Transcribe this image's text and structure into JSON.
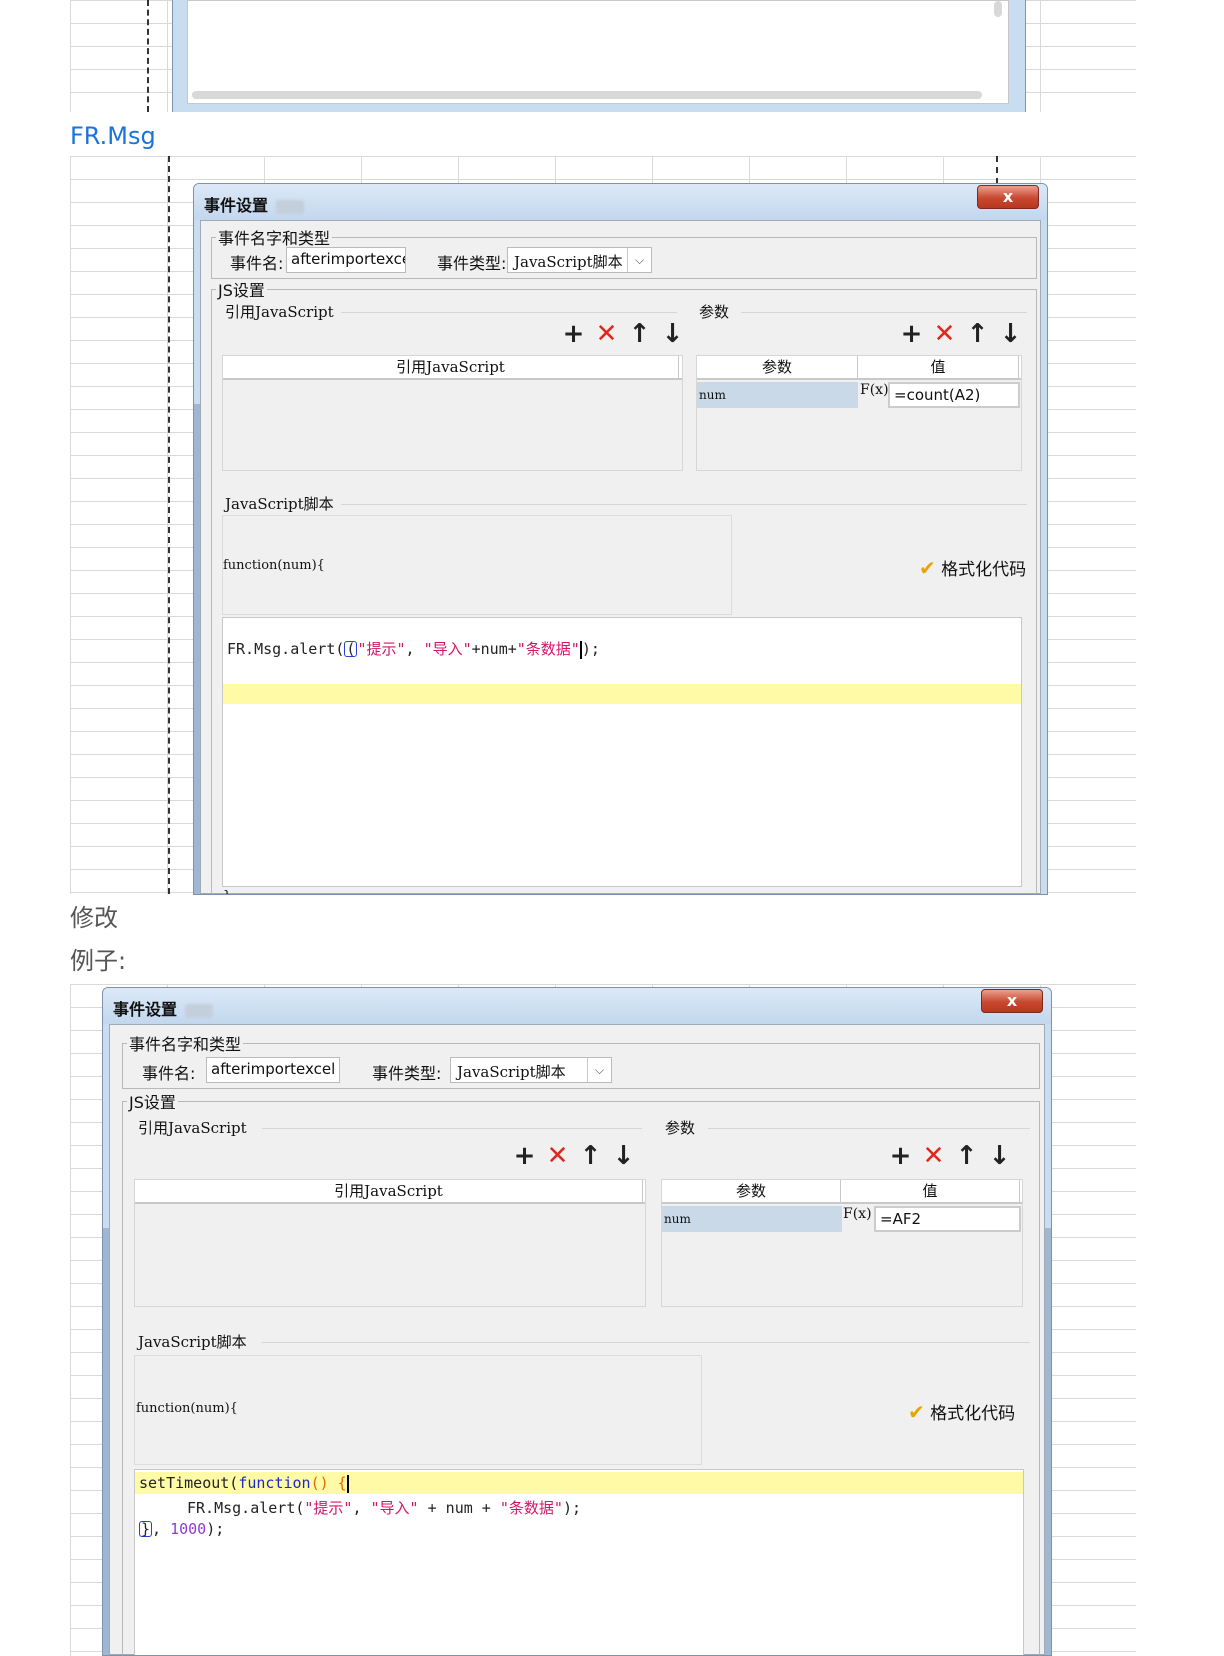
{
  "section1": {
    "heading": "FR.Msg"
  },
  "section2": {
    "heading": "修改"
  },
  "section3": {
    "heading": "例子:"
  },
  "dialog": {
    "title": "事件设置",
    "close_label": "x",
    "name_group_legend": "事件名字和类型",
    "event_name_label": "事件名:",
    "event_name_value": "afterimportexcel",
    "event_type_label": "事件类型:",
    "event_type_value": "JavaScript脚本",
    "js_group_legend": "JS设置",
    "ref_js_section": "引用JavaScript",
    "params_section": "参数",
    "toolbar": {
      "add": "+",
      "delete": "✕",
      "up": "↑",
      "down": "↓"
    },
    "ref_js_column": "引用JavaScript",
    "param_column": "参数",
    "value_column": "值",
    "param_name": "num",
    "fx_label": "F(x)",
    "script_section": "JavaScript脚本",
    "function_signature": "function(num){",
    "format_code_label": "格式化代码"
  },
  "dialog1": {
    "param_value": "=count(A2)",
    "code_line1_pre": "FR.Msg.alert(",
    "code_line1_str1": "\"提示\"",
    "code_line1_mid": ", ",
    "code_line1_str2": "\"导入\"",
    "code_line1_mid2": "+num+",
    "code_line1_str3": "\"条数据\"",
    "code_line1_end": ");",
    "closing_brace": "}"
  },
  "dialog2": {
    "param_value": "=AF2",
    "code_line1_fn": "setTimeout(",
    "code_line1_kw": "function",
    "code_line1_paren": "() {",
    "code_line2_pre": "FR.Msg.alert(",
    "code_line2_str1": "\"提示\"",
    "code_line2_mid": ", ",
    "code_line2_str2": "\"导入\"",
    "code_line2_mid2": " + num + ",
    "code_line2_str3": "\"条数据\"",
    "code_line2_end": ");",
    "code_line3_brace": "}",
    "code_line3_mid": ", ",
    "code_line3_num": "1000",
    "code_line3_end": ");"
  },
  "colors": {
    "link": "#1a73d9",
    "close": "#c9482f",
    "string": "#d4166a",
    "keyword": "#1d29c8",
    "highlight": "#fffaa5"
  }
}
